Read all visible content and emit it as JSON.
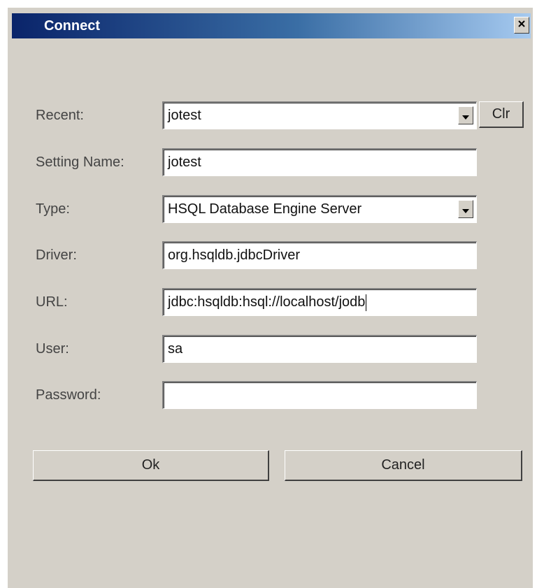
{
  "window": {
    "title": "Connect",
    "close_glyph": "✕"
  },
  "form": {
    "recent": {
      "label": "Recent:",
      "value": "jotest",
      "clear_label": "Clr"
    },
    "setting_name": {
      "label": "Setting Name:",
      "value": "jotest"
    },
    "type": {
      "label": "Type:",
      "value": "HSQL Database Engine Server"
    },
    "driver": {
      "label": "Driver:",
      "value": "org.hsqldb.jdbcDriver"
    },
    "url": {
      "label": "URL:",
      "value": "jdbc:hsqldb:hsql://localhost/jodb"
    },
    "user": {
      "label": "User:",
      "value": "sa"
    },
    "password": {
      "label": "Password:",
      "value": ""
    }
  },
  "buttons": {
    "ok_label": "Ok",
    "cancel_label": "Cancel"
  },
  "icons": {
    "close": "close-icon",
    "dropdown": "chevron-down-icon"
  },
  "colors": {
    "title_start": "#0a246a",
    "title_end": "#a6caf0",
    "face": "#d4d0c8"
  }
}
